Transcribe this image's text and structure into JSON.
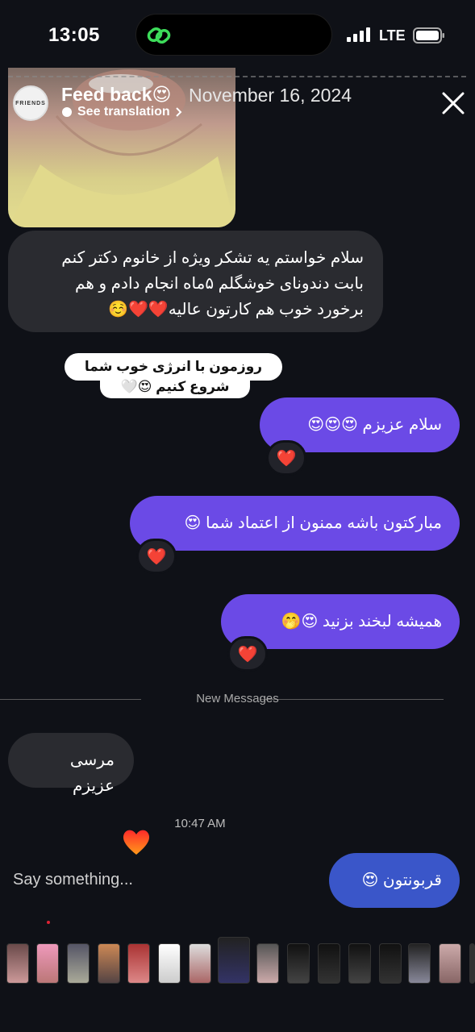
{
  "status_bar": {
    "time": "13:05",
    "network": "LTE"
  },
  "story": {
    "avatar_text": "FRIENDS",
    "title": "Feed back😍",
    "date": "November 16, 2024",
    "see_translation": "See translation"
  },
  "messages": {
    "incoming_1": "سلام خواستم یه تشکر ویژه از خانوم دکتر کنم بابت دندونای خوشگلم ۵ماه انجام دادم و هم برخورد خوب هم کارتون عالیه❤️❤️☺️",
    "sticker_line1": "روزمون با انرژی خوب شما",
    "sticker_line2": "شروع کنیم 😍🤍",
    "outgoing_1": "سلام عزیزم 😍😍😍",
    "outgoing_1_reaction": "❤️",
    "outgoing_2": "مبارکتون باشه ممنون از اعتماد شما 😍",
    "outgoing_2_reaction": "❤️",
    "outgoing_3": "همیشه لبخند بزنید 😍🤭",
    "outgoing_3_reaction": "❤️",
    "new_messages_label": "New Messages",
    "incoming_2": "مرسی عزیزم",
    "timestamp": "10:47 AM",
    "outgoing_4": "قربونتون 😍"
  },
  "input": {
    "placeholder": "Say something..."
  },
  "colors": {
    "background": "#0f1117",
    "incoming_bubble": "#2a2b30",
    "outgoing_bubble": "#6b4ae6",
    "outgoing_blue": "#3a56c9",
    "heart": "#e0192b"
  },
  "icons": [
    "link-icon",
    "signal-icon",
    "battery-icon",
    "close-icon",
    "chevron-right-icon",
    "heart-icon"
  ]
}
